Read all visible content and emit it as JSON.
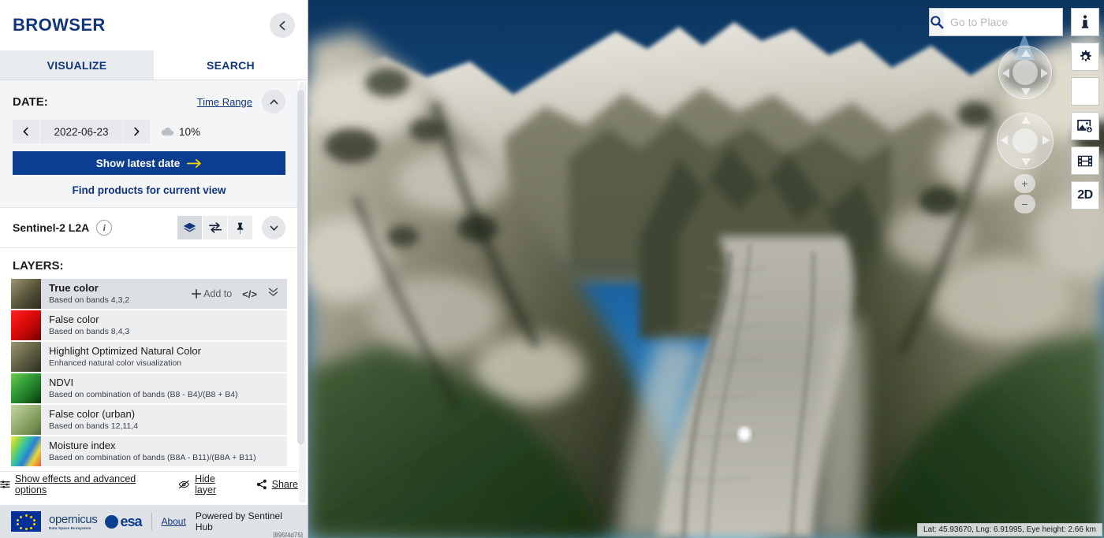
{
  "app": {
    "brand": "BROWSER",
    "build_hash": "[895f4d75]"
  },
  "tabs": [
    {
      "label": "VISUALIZE",
      "active": true
    },
    {
      "label": "SEARCH",
      "active": false
    }
  ],
  "date_section": {
    "label": "DATE:",
    "time_range_link": "Time Range",
    "date_value": "2022-06-23",
    "cloud_coverage": "10%",
    "latest_button": "Show latest date",
    "find_products": "Find products for current view"
  },
  "datasource": {
    "name": "Sentinel-2 L2A",
    "info_label": "i",
    "tools": [
      {
        "name": "layers-icon",
        "selected": true
      },
      {
        "name": "compare-icon",
        "selected": false
      },
      {
        "name": "pin-icon",
        "selected": false
      }
    ]
  },
  "layers": {
    "heading": "LAYERS:",
    "items": [
      {
        "title": "True color",
        "subtitle": "Based on bands 4,3,2",
        "selected": true,
        "thumb_from": "#8e8a6b",
        "thumb_to": "#3b3a2a",
        "actions": {
          "add_to": "Add to",
          "code": "</>"
        }
      },
      {
        "title": "False color",
        "subtitle": "Based on bands 8,4,3",
        "selected": false,
        "thumb_from": "#ff1414",
        "thumb_to": "#9c0000"
      },
      {
        "title": "Highlight Optimized Natural Color",
        "subtitle": "Enhanced natural color visualization",
        "selected": false,
        "thumb_from": "#8c8868",
        "thumb_to": "#36382a"
      },
      {
        "title": "NDVI",
        "subtitle": "Based on combination of bands (B8 - B4)/(B8 + B4)",
        "selected": false,
        "thumb_from": "#5cc14a",
        "thumb_to": "#0d4a10"
      },
      {
        "title": "False color (urban)",
        "subtitle": "Based on bands 12,11,4",
        "selected": false,
        "thumb_from": "#a8bd85",
        "thumb_to": "#5f7a46"
      },
      {
        "title": "Moisture index",
        "subtitle": "Based on combination of bands (B8A - B11)/(B8A + B11)",
        "selected": false,
        "thumb_from": "#f2e23a",
        "thumb_to": "#2b7ad1"
      }
    ],
    "footer": {
      "effects": "Show effects and advanced options",
      "hide_layer": "Hide layer",
      "share": "Share"
    }
  },
  "panel_footer": {
    "copernicus": "opernicus",
    "copernicus_sub": "Data Space Ecosystem",
    "esa": "esa",
    "about": "About",
    "powered": "Powered by Sentinel Hub"
  },
  "map": {
    "search_placeholder": "Go to Place",
    "search_value": "",
    "coordinates": "Lat: 45.93670, Lng: 6.91995, Eye height: 2.66 km",
    "tools": [
      {
        "name": "info-icon",
        "label": "i"
      },
      {
        "name": "settings-gear-icon",
        "label": ""
      },
      {
        "name": "lightbulb-icon",
        "label": ""
      },
      {
        "name": "download-image-icon",
        "label": ""
      },
      {
        "name": "timelapse-film-icon",
        "label": ""
      },
      {
        "name": "toggle-2d-button",
        "label": "2D"
      }
    ],
    "zoom_in": "+",
    "zoom_out": "−"
  },
  "colors": {
    "brand_blue": "#11367c",
    "button_blue": "#0b3d91",
    "arrow_yellow": "#ffd700",
    "sky_top": "#0b355f",
    "sky_bottom": "#5fb3e0"
  }
}
